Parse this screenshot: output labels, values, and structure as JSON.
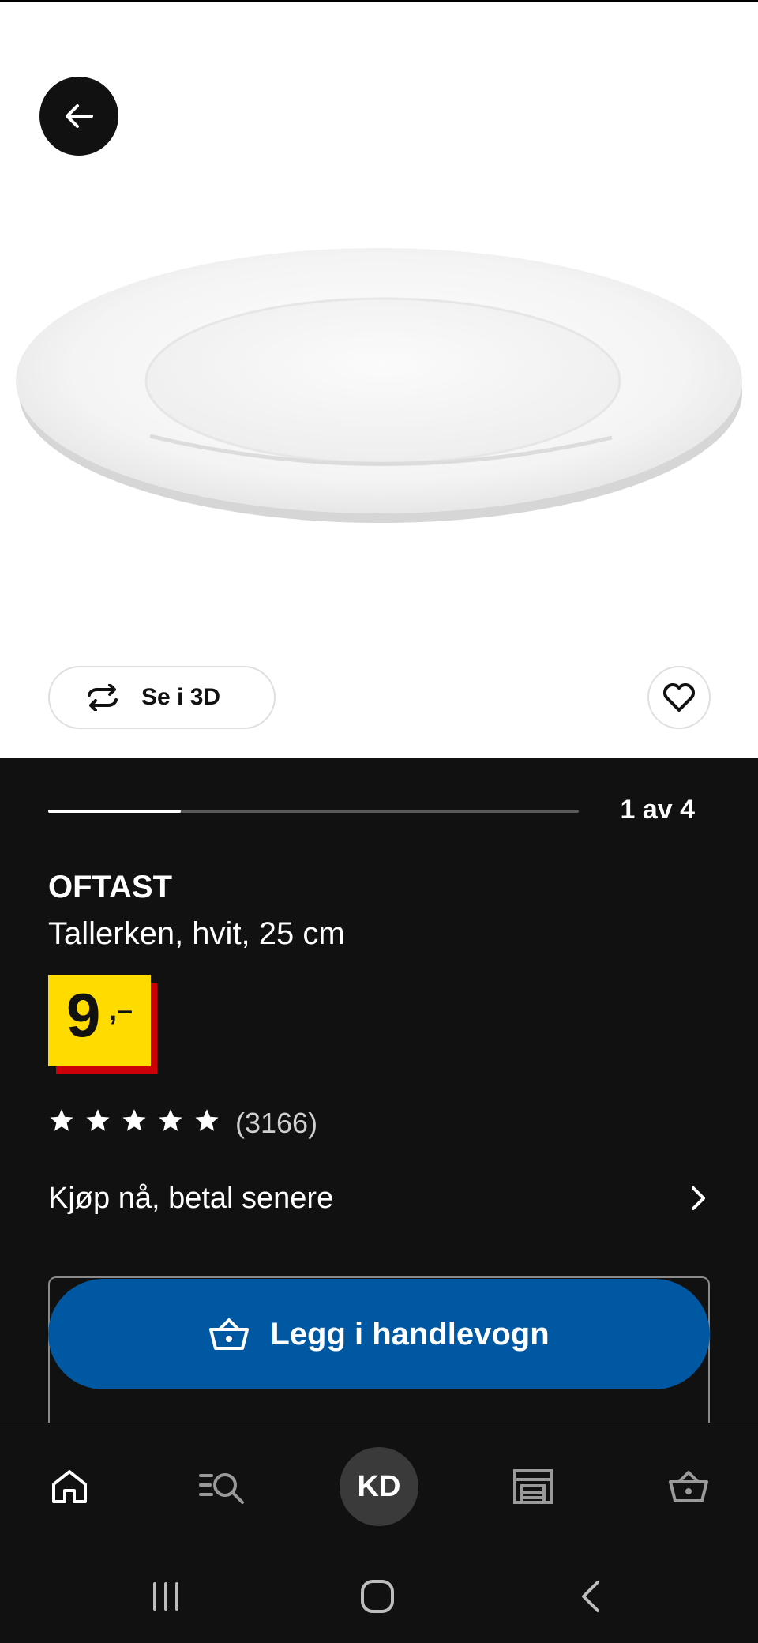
{
  "product": {
    "name": "OFTAST",
    "description": "Tallerken, hvit, 25 cm",
    "price_integer": "9",
    "price_decimal": ",–",
    "rating_count": "(3166)",
    "rating_stars": 5
  },
  "gallery": {
    "view_3d_label": "Se i 3D",
    "pager_text": "1 av 4",
    "progress": 0.25
  },
  "bnpl": {
    "label": "Kjøp nå, betal senere"
  },
  "cart": {
    "add_label": "Legg i handlevogn",
    "accent": "#0058a3"
  },
  "price_colors": {
    "box": "#ffdb00",
    "shadow": "#cc0008"
  },
  "nav": {
    "avatar_initials": "KD",
    "items": [
      "home-icon",
      "search-icon",
      "avatar",
      "store-icon",
      "cart-icon"
    ]
  },
  "system_nav": [
    "recents-icon",
    "home-circle-icon",
    "back-chevron-icon"
  ]
}
